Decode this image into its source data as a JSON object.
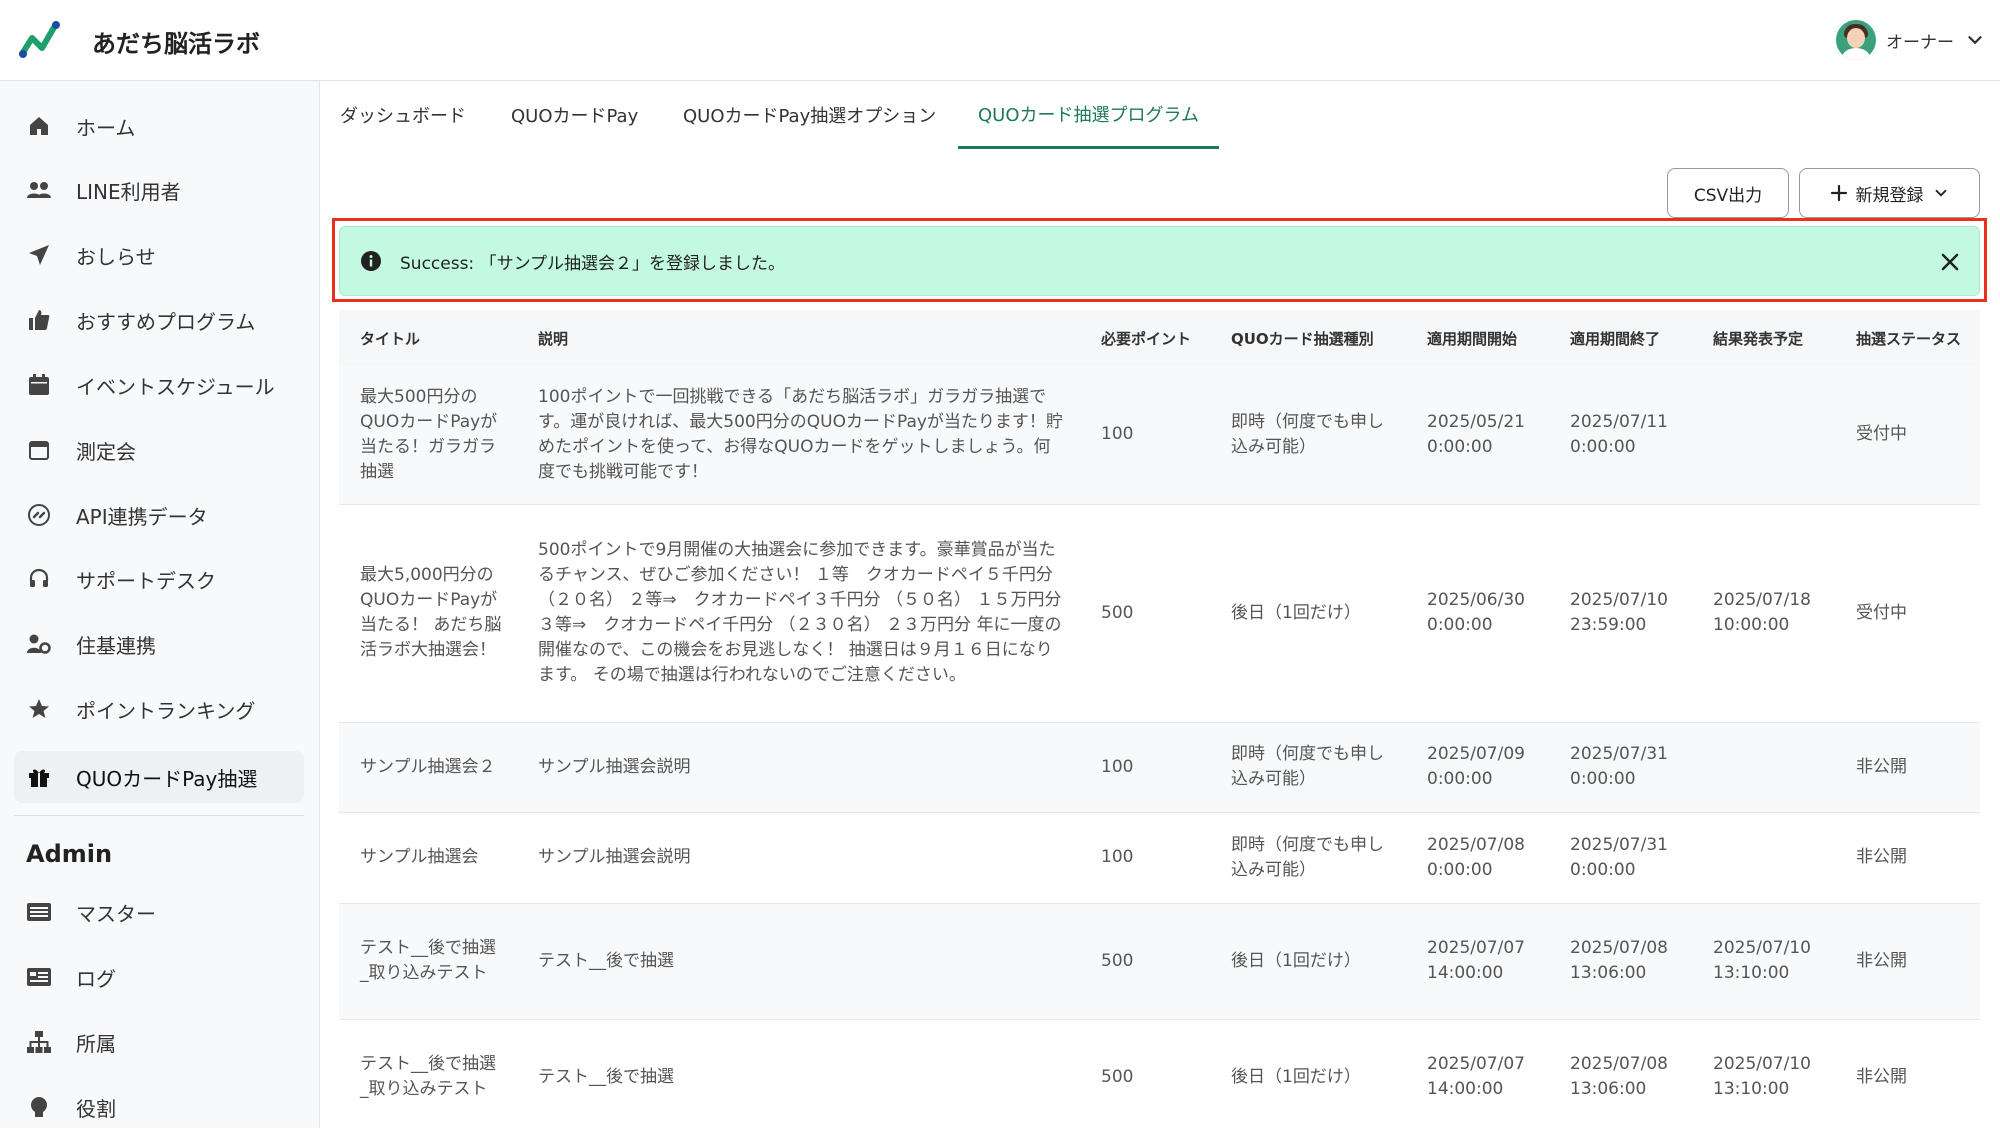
{
  "app": {
    "title": "あだち脳活ラボ"
  },
  "user": {
    "name": "オーナー"
  },
  "sidebar": {
    "items": [
      {
        "label": "ホーム",
        "icon": "home-icon"
      },
      {
        "label": "LINE利用者",
        "icon": "users-icon"
      },
      {
        "label": "おしらせ",
        "icon": "paper-plane-icon"
      },
      {
        "label": "おすすめプログラム",
        "icon": "thumbs-up-icon"
      },
      {
        "label": "イベントスケジュール",
        "icon": "calendar-icon"
      },
      {
        "label": "測定会",
        "icon": "calendar-outline-icon"
      },
      {
        "label": "API連携データ",
        "icon": "api-link-icon"
      },
      {
        "label": "サポートデスク",
        "icon": "headset-icon"
      },
      {
        "label": "住基連携",
        "icon": "user-gear-icon"
      },
      {
        "label": "ポイントランキング",
        "icon": "star-icon"
      },
      {
        "label": "QUOカードPay抽選",
        "icon": "gift-icon"
      }
    ],
    "admin_heading": "Admin",
    "admin_items": [
      {
        "label": "マスター",
        "icon": "master-list-icon"
      },
      {
        "label": "ログ",
        "icon": "log-icon"
      },
      {
        "label": "所属",
        "icon": "sitemap-icon"
      },
      {
        "label": "役割",
        "icon": "role-icon"
      }
    ]
  },
  "tabs": [
    {
      "label": "ダッシュボード"
    },
    {
      "label": "QUOカードPay"
    },
    {
      "label": "QUOカードPay抽選オプション"
    },
    {
      "label": "QUOカード抽選プログラム"
    }
  ],
  "toolbar": {
    "csv_label": "CSV出力",
    "new_label": "新規登録"
  },
  "alert": {
    "message": "Success: 「サンプル抽選会２」を登録しました。"
  },
  "table": {
    "headers": [
      "タイトル",
      "説明",
      "必要ポイント",
      "QUOカード抽選種別",
      "適用期間開始",
      "適用期間終了",
      "結果発表予定",
      "抽選ステータス"
    ],
    "rows": [
      {
        "title": "最大500円分のQUOカードPayが当たる！ガラガラ抽選",
        "description": "100ポイントで一回挑戦できる「あだち脳活ラボ」ガラガラ抽選です。運が良ければ、最大500円分のQUOカードPayが当たります！貯めたポイントを使って、お得なQUOカードをゲットしましょう。何度でも挑戦可能です！",
        "points": "100",
        "type": "即時（何度でも申し込み可能）",
        "start": "2025/05/21 0:00:00",
        "end": "2025/07/11 0:00:00",
        "announce": "",
        "status": "受付中"
      },
      {
        "title": "最大5,000円分のQUOカードPayが当たる！ あだち脳活ラボ大抽選会！",
        "description": "500ポイントで9月開催の大抽選会に参加できます。豪華賞品が当たるチャンス、ぜひご参加ください！ １等　クオカードペイ５千円分 （２０名） ２等⇒　クオカードペイ３千円分 （５０名） １５万円分 ３等⇒　クオカードペイ千円分 （２３０名） ２３万円分 年に一度の開催なので、この機会をお見逃しなく！ 抽選日は９月１６日になります。 その場で抽選は行われないのでご注意ください。",
        "points": "500",
        "type": "後日（1回だけ）",
        "start": "2025/06/30 0:00:00",
        "end": "2025/07/10 23:59:00",
        "announce": "2025/07/18 10:00:00",
        "status": "受付中"
      },
      {
        "title": "サンプル抽選会２",
        "description": "サンプル抽選会説明",
        "points": "100",
        "type": "即時（何度でも申し込み可能）",
        "start": "2025/07/09 0:00:00",
        "end": "2025/07/31 0:00:00",
        "announce": "",
        "status": "非公開"
      },
      {
        "title": "サンプル抽選会",
        "description": "サンプル抽選会説明",
        "points": "100",
        "type": "即時（何度でも申し込み可能）",
        "start": "2025/07/08 0:00:00",
        "end": "2025/07/31 0:00:00",
        "announce": "",
        "status": "非公開"
      },
      {
        "title": "テスト__後で抽選_取り込みテスト",
        "description": "テスト__後で抽選",
        "points": "500",
        "type": "後日（1回だけ）",
        "start": "2025/07/07 14:00:00",
        "end": "2025/07/08 13:06:00",
        "announce": "2025/07/10 13:10:00",
        "status": "非公開"
      },
      {
        "title": "テスト__後で抽選_取り込みテスト",
        "description": "テスト__後で抽選",
        "points": "500",
        "type": "後日（1回だけ）",
        "start": "2025/07/07 14:00:00",
        "end": "2025/07/08 13:06:00",
        "announce": "2025/07/10 13:10:00",
        "status": "非公開"
      }
    ]
  }
}
